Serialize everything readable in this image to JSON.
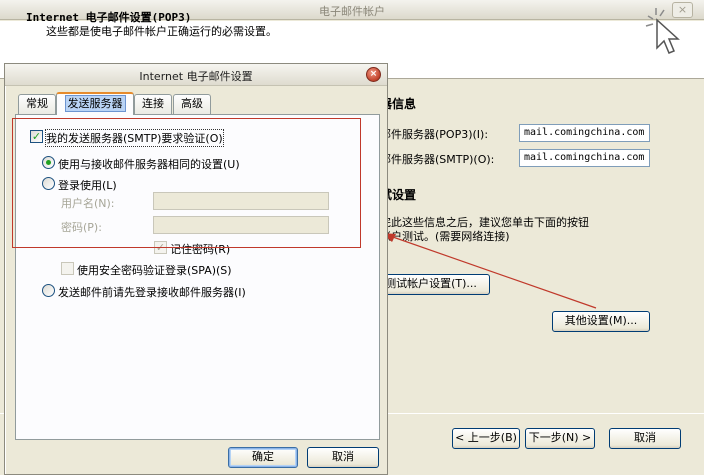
{
  "wizard": {
    "title": "电子邮件帐户",
    "close": "×",
    "header_title": "Internet 电子邮件设置(POP3)",
    "header_subtitle": "这些都是使电子邮件帐户正确运行的必需设置。",
    "server_info_heading": "器信息",
    "incoming_label": "邮件服务器(POP3)(I):",
    "incoming_value": "mail.comingchina.com",
    "outgoing_label": "邮件服务器(SMTP)(O):",
    "outgoing_value": "mail.comingchina.com",
    "test_heading": "试设置",
    "test_desc_line1": "完此这些信息之后，建议您单击下面的按钮",
    "test_desc_line2": "帐户测试。(需要网络连接)",
    "test_button": "测试帐户设置(T)...",
    "more_button": "其他设置(M)...",
    "back_button": "< 上一步(B)",
    "next_button": "下一步(N) >",
    "cancel_button": "取消"
  },
  "dialog": {
    "title": "Internet 电子邮件设置",
    "close": "×",
    "tabs": [
      {
        "label": "常规"
      },
      {
        "label": "发送服务器"
      },
      {
        "label": "连接"
      },
      {
        "label": "高级"
      }
    ],
    "smtp_auth_label": "我的发送服务器(SMTP)要求验证(O)",
    "same_as_incoming_label": "使用与接收邮件服务器相同的设置(U)",
    "login_with_label": "登录使用(L)",
    "username_label": "用户名(N):",
    "password_label": "密码(P):",
    "remember_password_label": "记住密码(R)",
    "spa_label": "使用安全密码验证登录(SPA)(S)",
    "login_before_send_label": "发送邮件前请先登录接收邮件服务器(I)",
    "ok_button": "确定",
    "cancel_button": "取消"
  },
  "colors": {
    "xp_face": "#ece9d8",
    "annotation_red": "#c0392b",
    "check_green": "#21a121"
  }
}
